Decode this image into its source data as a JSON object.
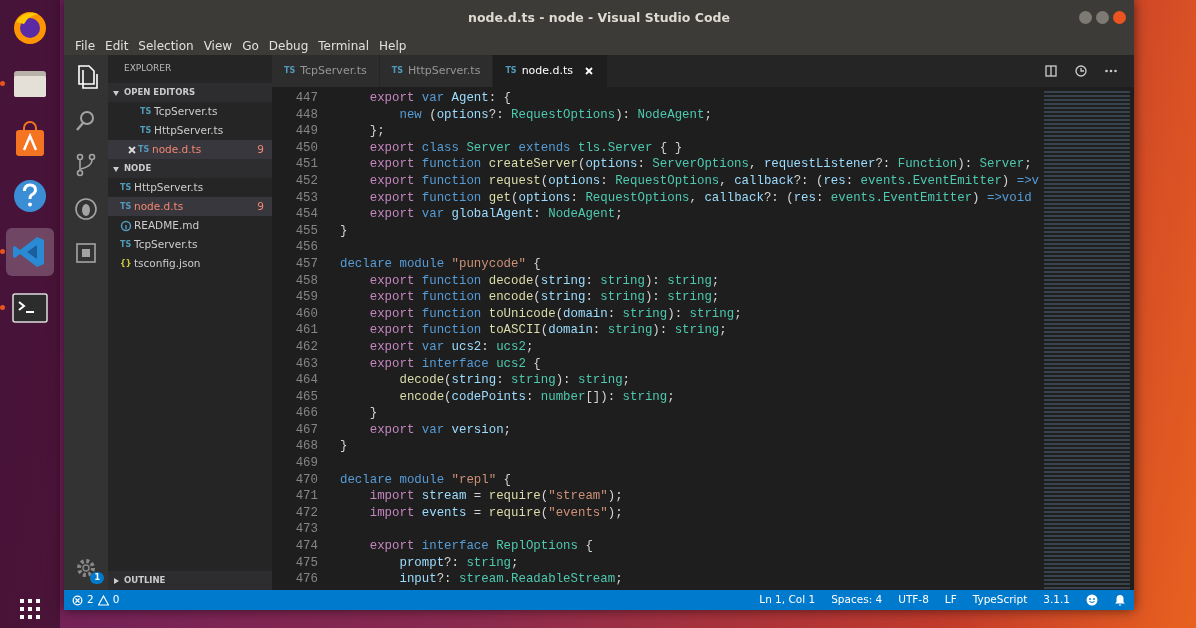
{
  "dock": {
    "items": [
      {
        "kind": "browser",
        "running": false,
        "selected": false
      },
      {
        "kind": "files",
        "running": true,
        "selected": false
      },
      {
        "kind": "software",
        "running": false,
        "selected": false
      },
      {
        "kind": "help",
        "running": false,
        "selected": false
      },
      {
        "kind": "code",
        "running": true,
        "selected": true
      },
      {
        "kind": "terminal",
        "running": true,
        "selected": false
      }
    ]
  },
  "window": {
    "title": "node.d.ts - node - Visual Studio Code"
  },
  "menu": [
    "File",
    "Edit",
    "Selection",
    "View",
    "Go",
    "Debug",
    "Terminal",
    "Help"
  ],
  "activity_bar": {
    "items": [
      {
        "kind": "files",
        "selected": true
      },
      {
        "kind": "search",
        "selected": false
      },
      {
        "kind": "source-control",
        "selected": false
      },
      {
        "kind": "debug",
        "selected": false
      },
      {
        "kind": "extensions",
        "selected": false
      }
    ],
    "settings_badge": "1"
  },
  "sidebar": {
    "title": "EXPLORER",
    "sections": [
      {
        "title": "OPEN EDITORS",
        "expanded": true,
        "items": [
          {
            "kind": "ts",
            "icon_text": "TS",
            "name": "TcpServer.ts",
            "selected": false,
            "has_errors": false
          },
          {
            "kind": "ts",
            "icon_text": "TS",
            "name": "HttpServer.ts",
            "selected": false,
            "has_errors": false
          },
          {
            "kind": "ts",
            "icon_text": "TS",
            "name": "node.d.ts",
            "selected": true,
            "has_errors": true,
            "badge": "9"
          }
        ]
      },
      {
        "title": "NODE",
        "expanded": true,
        "items": [
          {
            "kind": "ts",
            "icon_text": "TS",
            "name": "HttpServer.ts",
            "selected": false,
            "has_errors": false
          },
          {
            "kind": "ts",
            "icon_text": "TS",
            "name": "node.d.ts",
            "selected": true,
            "has_errors": true,
            "badge": "9"
          },
          {
            "kind": "md",
            "name": "README.md",
            "selected": false,
            "has_errors": false
          },
          {
            "kind": "ts",
            "icon_text": "TS",
            "name": "TcpServer.ts",
            "selected": false,
            "has_errors": false
          },
          {
            "kind": "json",
            "icon_text": "{}",
            "name": "tsconfig.json",
            "selected": false,
            "has_errors": false
          }
        ]
      },
      {
        "title": "OUTLINE",
        "expanded": false
      }
    ]
  },
  "tabs": [
    {
      "icon_text": "TS",
      "label": "TcpServer.ts",
      "selected": false
    },
    {
      "icon_text": "TS",
      "label": "HttpServer.ts",
      "selected": false
    },
    {
      "icon_text": "TS",
      "label": "node.d.ts",
      "selected": true
    }
  ],
  "editor": {
    "lines": [
      {
        "number": "447",
        "tokens": [
          {
            "kind": "keyword",
            "text": "    export "
          },
          {
            "kind": "storage",
            "text": "var "
          },
          {
            "kind": "variable",
            "text": "Agent"
          },
          {
            "kind": "plain",
            "text": ": {"
          }
        ]
      },
      {
        "number": "448",
        "tokens": [
          {
            "kind": "storage",
            "text": "        new "
          },
          {
            "kind": "plain",
            "text": "("
          },
          {
            "kind": "variable",
            "text": "options"
          },
          {
            "kind": "plain",
            "text": "?: "
          },
          {
            "kind": "type",
            "text": "RequestOptions"
          },
          {
            "kind": "plain",
            "text": "): "
          },
          {
            "kind": "type",
            "text": "NodeAgent"
          },
          {
            "kind": "plain",
            "text": ";"
          }
        ]
      },
      {
        "number": "449",
        "tokens": [
          {
            "kind": "plain",
            "text": "    };"
          }
        ]
      },
      {
        "number": "450",
        "tokens": [
          {
            "kind": "keyword",
            "text": "    export "
          },
          {
            "kind": "storage",
            "text": "class "
          },
          {
            "kind": "type",
            "text": "Server "
          },
          {
            "kind": "storage",
            "text": "extends "
          },
          {
            "kind": "type",
            "text": "tls.Server "
          },
          {
            "kind": "plain",
            "text": "{ }"
          }
        ]
      },
      {
        "number": "451",
        "tokens": [
          {
            "kind": "keyword",
            "text": "    export "
          },
          {
            "kind": "storage",
            "text": "function "
          },
          {
            "kind": "function",
            "text": "createServer"
          },
          {
            "kind": "plain",
            "text": "("
          },
          {
            "kind": "variable",
            "text": "options"
          },
          {
            "kind": "plain",
            "text": ": "
          },
          {
            "kind": "type",
            "text": "ServerOptions"
          },
          {
            "kind": "plain",
            "text": ", "
          },
          {
            "kind": "variable",
            "text": "requestListener"
          },
          {
            "kind": "plain",
            "text": "?: "
          },
          {
            "kind": "type",
            "text": "Function"
          },
          {
            "kind": "plain",
            "text": "): "
          },
          {
            "kind": "type",
            "text": "Server"
          },
          {
            "kind": "plain",
            "text": ";"
          }
        ]
      },
      {
        "number": "452",
        "tokens": [
          {
            "kind": "keyword",
            "text": "    export "
          },
          {
            "kind": "storage",
            "text": "function "
          },
          {
            "kind": "function",
            "text": "request"
          },
          {
            "kind": "plain",
            "text": "("
          },
          {
            "kind": "variable",
            "text": "options"
          },
          {
            "kind": "plain",
            "text": ": "
          },
          {
            "kind": "type",
            "text": "RequestOptions"
          },
          {
            "kind": "plain",
            "text": ", "
          },
          {
            "kind": "variable",
            "text": "callback"
          },
          {
            "kind": "plain",
            "text": "?: ("
          },
          {
            "kind": "variable",
            "text": "res"
          },
          {
            "kind": "plain",
            "text": ": "
          },
          {
            "kind": "type",
            "text": "events.EventEmitter"
          },
          {
            "kind": "plain",
            "text": ") "
          },
          {
            "kind": "storage",
            "text": "=>v"
          }
        ]
      },
      {
        "number": "453",
        "tokens": [
          {
            "kind": "keyword",
            "text": "    export "
          },
          {
            "kind": "storage",
            "text": "function "
          },
          {
            "kind": "function",
            "text": "get"
          },
          {
            "kind": "plain",
            "text": "("
          },
          {
            "kind": "variable",
            "text": "options"
          },
          {
            "kind": "plain",
            "text": ": "
          },
          {
            "kind": "type",
            "text": "RequestOptions"
          },
          {
            "kind": "plain",
            "text": ", "
          },
          {
            "kind": "variable",
            "text": "callback"
          },
          {
            "kind": "plain",
            "text": "?: ("
          },
          {
            "kind": "variable",
            "text": "res"
          },
          {
            "kind": "plain",
            "text": ": "
          },
          {
            "kind": "type",
            "text": "events.EventEmitter"
          },
          {
            "kind": "plain",
            "text": ") "
          },
          {
            "kind": "storage",
            "text": "=>void"
          }
        ]
      },
      {
        "number": "454",
        "tokens": [
          {
            "kind": "keyword",
            "text": "    export "
          },
          {
            "kind": "storage",
            "text": "var "
          },
          {
            "kind": "variable",
            "text": "globalAgent"
          },
          {
            "kind": "plain",
            "text": ": "
          },
          {
            "kind": "type",
            "text": "NodeAgent"
          },
          {
            "kind": "plain",
            "text": ";"
          }
        ]
      },
      {
        "number": "455",
        "tokens": [
          {
            "kind": "plain",
            "text": "}"
          }
        ]
      },
      {
        "number": "456"
      },
      {
        "number": "457",
        "tokens": [
          {
            "kind": "storage",
            "text": "declare module "
          },
          {
            "kind": "string",
            "text": "\"punycode\""
          },
          {
            "kind": "plain",
            "text": " {"
          }
        ]
      },
      {
        "number": "458",
        "tokens": [
          {
            "kind": "keyword",
            "text": "    export "
          },
          {
            "kind": "storage",
            "text": "function "
          },
          {
            "kind": "function",
            "text": "decode"
          },
          {
            "kind": "plain",
            "text": "("
          },
          {
            "kind": "variable",
            "text": "string"
          },
          {
            "kind": "plain",
            "text": ": "
          },
          {
            "kind": "type",
            "text": "string"
          },
          {
            "kind": "plain",
            "text": "): "
          },
          {
            "kind": "type",
            "text": "string"
          },
          {
            "kind": "plain",
            "text": ";"
          }
        ]
      },
      {
        "number": "459",
        "tokens": [
          {
            "kind": "keyword",
            "text": "    export "
          },
          {
            "kind": "storage",
            "text": "function "
          },
          {
            "kind": "function",
            "text": "encode"
          },
          {
            "kind": "plain",
            "text": "("
          },
          {
            "kind": "variable",
            "text": "string"
          },
          {
            "kind": "plain",
            "text": ": "
          },
          {
            "kind": "type",
            "text": "string"
          },
          {
            "kind": "plain",
            "text": "): "
          },
          {
            "kind": "type",
            "text": "string"
          },
          {
            "kind": "plain",
            "text": ";"
          }
        ]
      },
      {
        "number": "460",
        "tokens": [
          {
            "kind": "keyword",
            "text": "    export "
          },
          {
            "kind": "storage",
            "text": "function "
          },
          {
            "kind": "function",
            "text": "toUnicode"
          },
          {
            "kind": "plain",
            "text": "("
          },
          {
            "kind": "variable",
            "text": "domain"
          },
          {
            "kind": "plain",
            "text": ": "
          },
          {
            "kind": "type",
            "text": "string"
          },
          {
            "kind": "plain",
            "text": "): "
          },
          {
            "kind": "type",
            "text": "string"
          },
          {
            "kind": "plain",
            "text": ";"
          }
        ]
      },
      {
        "number": "461",
        "tokens": [
          {
            "kind": "keyword",
            "text": "    export "
          },
          {
            "kind": "storage",
            "text": "function "
          },
          {
            "kind": "function",
            "text": "toASCII"
          },
          {
            "kind": "plain",
            "text": "("
          },
          {
            "kind": "variable",
            "text": "domain"
          },
          {
            "kind": "plain",
            "text": ": "
          },
          {
            "kind": "type",
            "text": "string"
          },
          {
            "kind": "plain",
            "text": "): "
          },
          {
            "kind": "type",
            "text": "string"
          },
          {
            "kind": "plain",
            "text": ";"
          }
        ]
      },
      {
        "number": "462",
        "tokens": [
          {
            "kind": "keyword",
            "text": "    export "
          },
          {
            "kind": "storage",
            "text": "var "
          },
          {
            "kind": "variable",
            "text": "ucs2"
          },
          {
            "kind": "plain",
            "text": ": "
          },
          {
            "kind": "type",
            "text": "ucs2"
          },
          {
            "kind": "plain",
            "text": ";"
          }
        ]
      },
      {
        "number": "463",
        "tokens": [
          {
            "kind": "keyword",
            "text": "    export "
          },
          {
            "kind": "storage",
            "text": "interface "
          },
          {
            "kind": "type",
            "text": "ucs2"
          },
          {
            "kind": "plain",
            "text": " {"
          }
        ]
      },
      {
        "number": "464",
        "tokens": [
          {
            "kind": "function",
            "text": "        decode"
          },
          {
            "kind": "plain",
            "text": "("
          },
          {
            "kind": "variable",
            "text": "string"
          },
          {
            "kind": "plain",
            "text": ": "
          },
          {
            "kind": "type",
            "text": "string"
          },
          {
            "kind": "plain",
            "text": "): "
          },
          {
            "kind": "type",
            "text": "string"
          },
          {
            "kind": "plain",
            "text": ";"
          }
        ]
      },
      {
        "number": "465",
        "tokens": [
          {
            "kind": "function",
            "text": "        encode"
          },
          {
            "kind": "plain",
            "text": "("
          },
          {
            "kind": "variable",
            "text": "codePoints"
          },
          {
            "kind": "plain",
            "text": ": "
          },
          {
            "kind": "type",
            "text": "number"
          },
          {
            "kind": "plain",
            "text": "[]): "
          },
          {
            "kind": "type",
            "text": "string"
          },
          {
            "kind": "plain",
            "text": ";"
          }
        ]
      },
      {
        "number": "466",
        "tokens": [
          {
            "kind": "plain",
            "text": "    }"
          }
        ]
      },
      {
        "number": "467",
        "tokens": [
          {
            "kind": "keyword",
            "text": "    export "
          },
          {
            "kind": "storage",
            "text": "var "
          },
          {
            "kind": "variable",
            "text": "version"
          },
          {
            "kind": "plain",
            "text": ";"
          }
        ]
      },
      {
        "number": "468",
        "tokens": [
          {
            "kind": "plain",
            "text": "}"
          }
        ]
      },
      {
        "number": "469"
      },
      {
        "number": "470",
        "tokens": [
          {
            "kind": "storage",
            "text": "declare module "
          },
          {
            "kind": "string",
            "text": "\"repl\""
          },
          {
            "kind": "plain",
            "text": " {"
          }
        ]
      },
      {
        "number": "471",
        "tokens": [
          {
            "kind": "keyword",
            "text": "    import "
          },
          {
            "kind": "variable",
            "text": "stream"
          },
          {
            "kind": "plain",
            "text": " = "
          },
          {
            "kind": "function",
            "text": "require"
          },
          {
            "kind": "plain",
            "text": "("
          },
          {
            "kind": "string",
            "text": "\"stream\""
          },
          {
            "kind": "plain",
            "text": ");"
          }
        ]
      },
      {
        "number": "472",
        "tokens": [
          {
            "kind": "keyword",
            "text": "    import "
          },
          {
            "kind": "variable",
            "text": "events"
          },
          {
            "kind": "plain",
            "text": " = "
          },
          {
            "kind": "function",
            "text": "require"
          },
          {
            "kind": "plain",
            "text": "("
          },
          {
            "kind": "string",
            "text": "\"events\""
          },
          {
            "kind": "plain",
            "text": ");"
          }
        ]
      },
      {
        "number": "473"
      },
      {
        "number": "474",
        "tokens": [
          {
            "kind": "keyword",
            "text": "    export "
          },
          {
            "kind": "storage",
            "text": "interface "
          },
          {
            "kind": "type",
            "text": "ReplOptions"
          },
          {
            "kind": "plain",
            "text": " {"
          }
        ]
      },
      {
        "number": "475",
        "tokens": [
          {
            "kind": "variable",
            "text": "        prompt"
          },
          {
            "kind": "plain",
            "text": "?: "
          },
          {
            "kind": "type",
            "text": "string"
          },
          {
            "kind": "plain",
            "text": ";"
          }
        ]
      },
      {
        "number": "476",
        "tokens": [
          {
            "kind": "variable",
            "text": "        input"
          },
          {
            "kind": "plain",
            "text": "?: "
          },
          {
            "kind": "type",
            "text": "stream.ReadableStream"
          },
          {
            "kind": "plain",
            "text": ";"
          }
        ]
      }
    ]
  },
  "status_bar": {
    "errors": "2",
    "warnings": "0",
    "items": [
      "Ln 1, Col 1",
      "Spaces: 4",
      "UTF-8",
      "LF",
      "TypeScript",
      "3.1.1"
    ]
  }
}
